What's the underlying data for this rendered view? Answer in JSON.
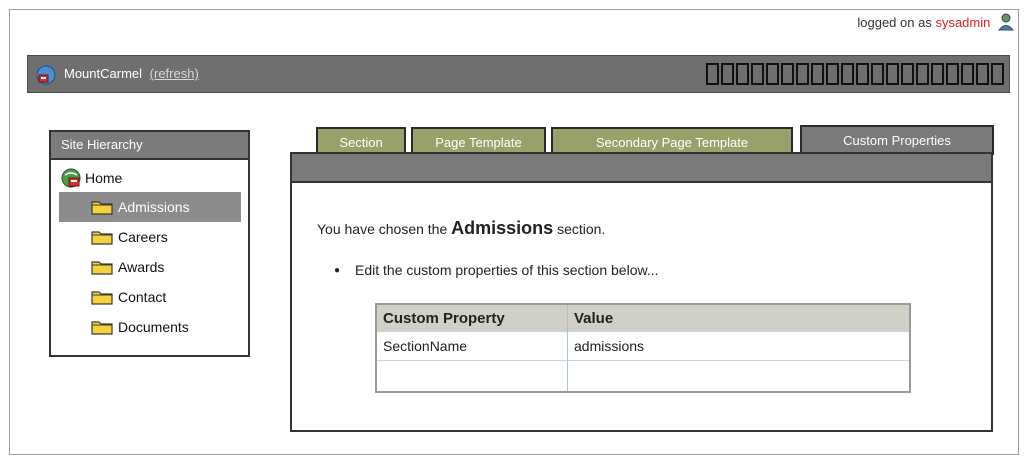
{
  "header": {
    "logged_on_prefix": "logged on as",
    "username": "sysadmin"
  },
  "appbar": {
    "title": "MountCarmel",
    "refresh_label": "(refresh)",
    "box_count": 20
  },
  "site_hierarchy": {
    "title": "Site Hierarchy",
    "root": "Home",
    "items": [
      {
        "label": "Admissions",
        "selected": true
      },
      {
        "label": "Careers",
        "selected": false
      },
      {
        "label": "Awards",
        "selected": false
      },
      {
        "label": "Contact",
        "selected": false
      },
      {
        "label": "Documents",
        "selected": false
      }
    ]
  },
  "tabs": [
    {
      "label": "Section",
      "active": false
    },
    {
      "label": "Page Template",
      "active": false
    },
    {
      "label": "Secondary Page Template",
      "active": false
    },
    {
      "label": "Custom Properties",
      "active": true
    }
  ],
  "content": {
    "chosen_prefix": "You have chosen the",
    "section_name": "Admissions",
    "chosen_suffix": "section.",
    "instruction": "Edit the custom properties of this section below..."
  },
  "properties_table": {
    "headers": [
      "Custom Property",
      "Value"
    ],
    "rows": [
      [
        "SectionName",
        "admissions"
      ],
      [
        "",
        ""
      ]
    ]
  },
  "colors": {
    "tab_inactive": "#9aa06a",
    "tab_active": "#7a7a7a",
    "appbar": "#6f6f6f",
    "username": "#e02020"
  }
}
